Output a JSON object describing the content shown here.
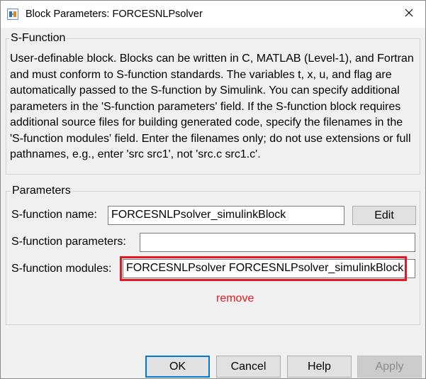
{
  "window": {
    "title": "Block Parameters: FORCESNLPsolver"
  },
  "sfunction_group": {
    "title": "S-Function",
    "description": "User-definable block.  Blocks can be written in C, MATLAB (Level-1), and Fortran and must conform to S-function standards.  The variables t, x, u, and flag are automatically passed to the S-function by Simulink.  You can specify additional parameters in the 'S-function parameters' field. If the S-function block requires additional source files for building generated code, specify the filenames in the 'S-function modules' field. Enter the filenames only; do not use extensions or full pathnames, e.g., enter 'src src1', not 'src.c src1.c'."
  },
  "parameters_group": {
    "title": "Parameters",
    "name_label": "S-function name:",
    "name_value": "FORCESNLPsolver_simulinkBlock",
    "edit_label": "Edit",
    "params_label": "S-function parameters:",
    "params_value": "",
    "modules_label": "S-function modules:",
    "modules_value": "FORCESNLPsolver FORCESNLPsolver_simulinkBlock"
  },
  "annotation": {
    "text": "remove",
    "color": "#e8171f"
  },
  "buttons": {
    "ok": "OK",
    "cancel": "Cancel",
    "help": "Help",
    "apply": "Apply"
  },
  "colors": {
    "accent": "#0078d7",
    "highlight": "#e8171f"
  },
  "icons": {
    "app": "simulink-block-icon",
    "close": "close-icon"
  }
}
